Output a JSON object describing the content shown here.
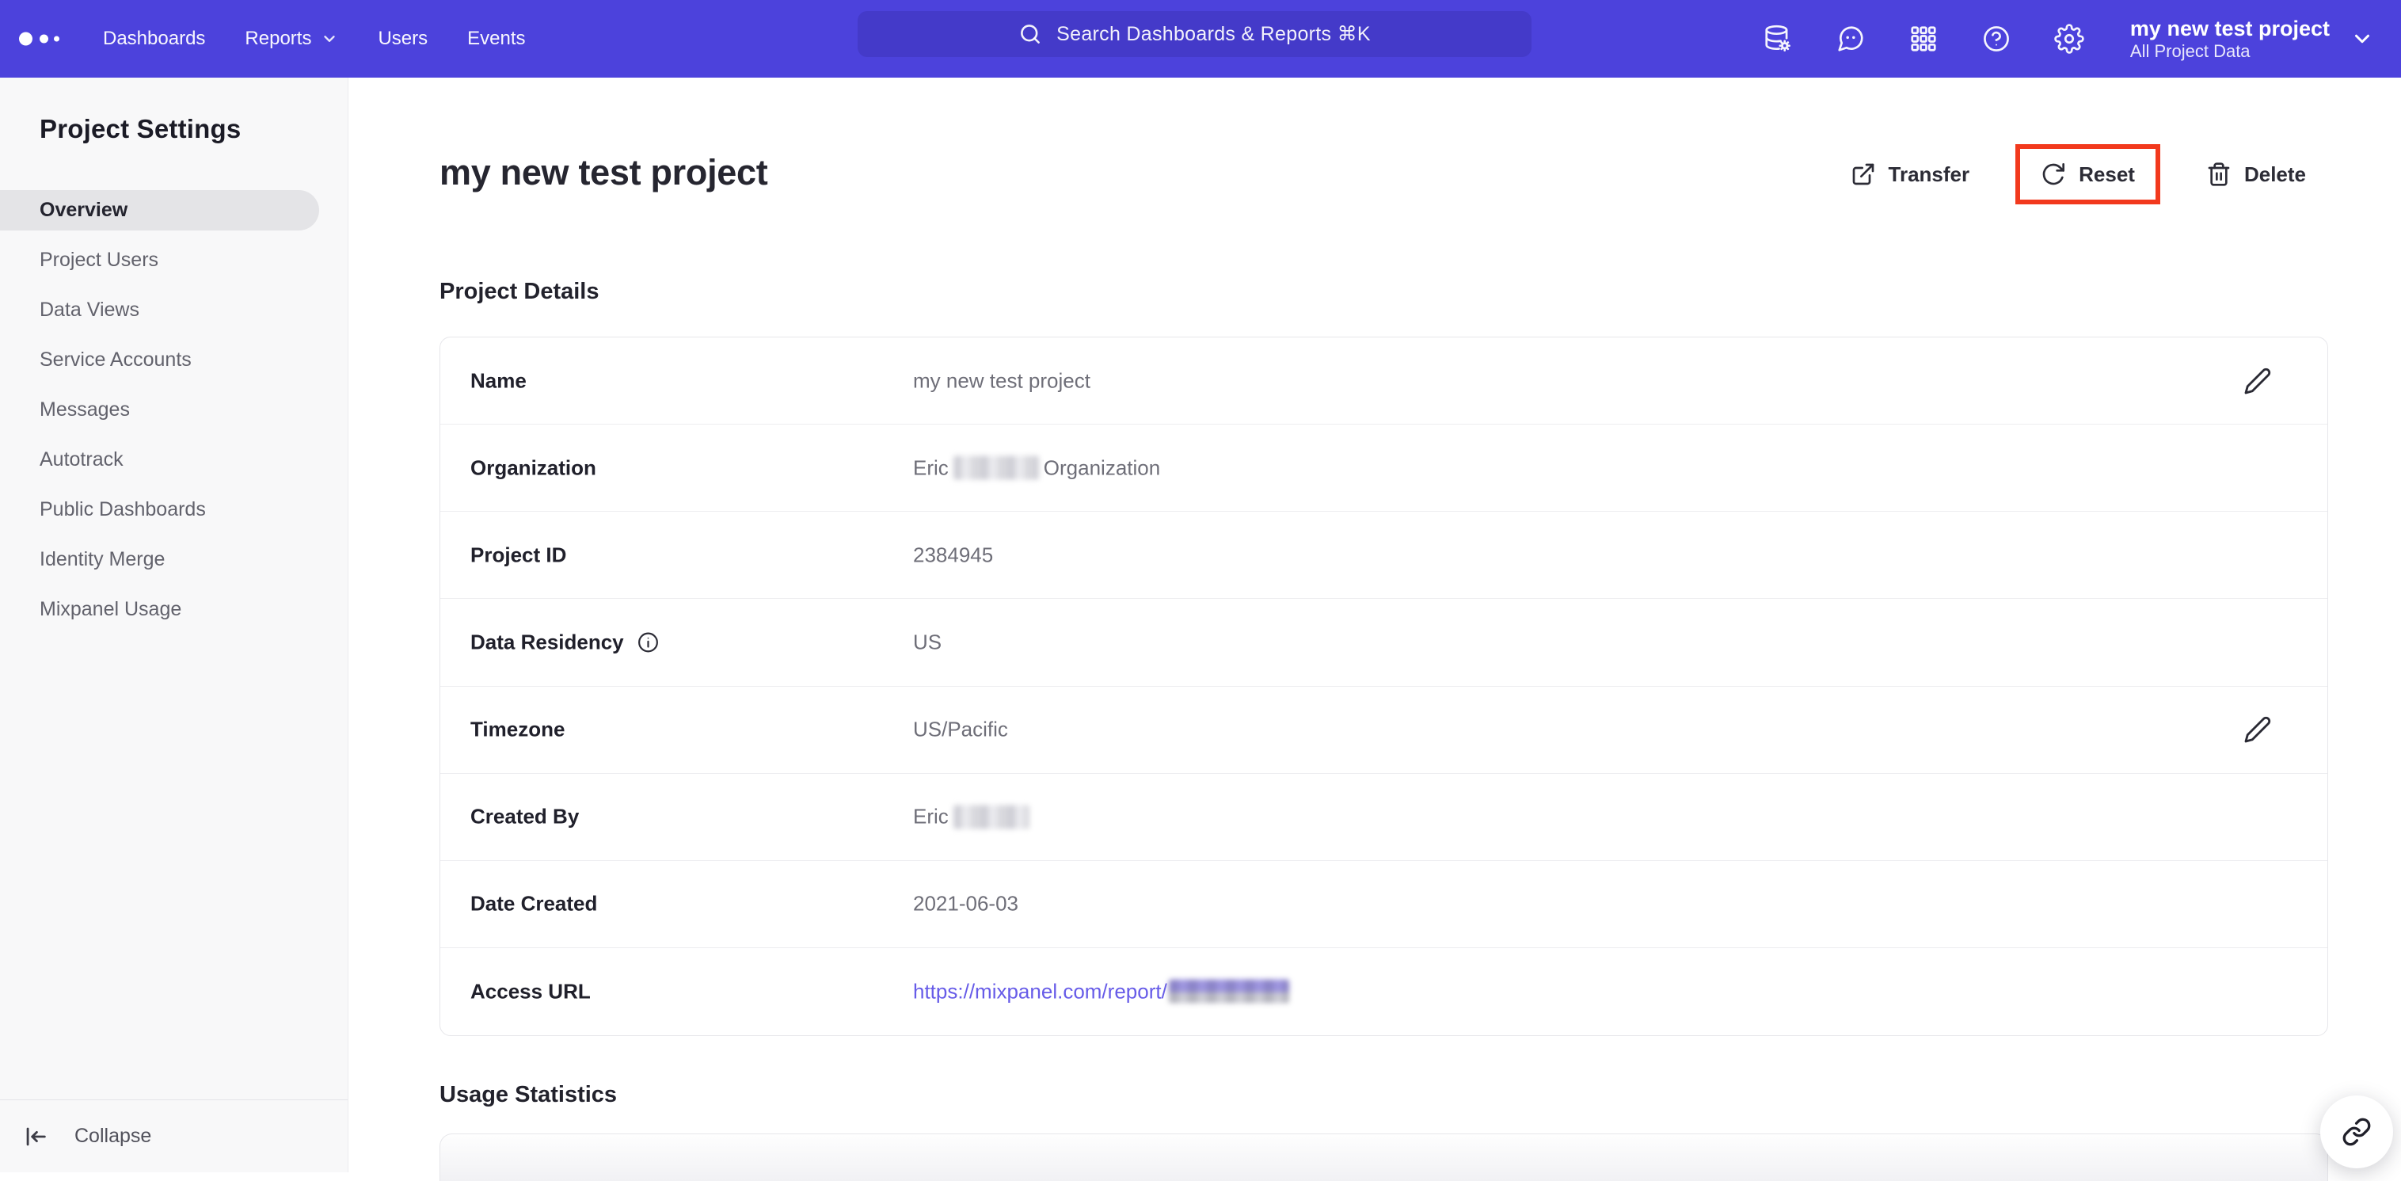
{
  "nav": {
    "items": [
      {
        "label": "Dashboards"
      },
      {
        "label": "Reports"
      },
      {
        "label": "Users"
      },
      {
        "label": "Events"
      }
    ],
    "search_placeholder": "Search Dashboards & Reports ⌘K",
    "project_name": "my new test project",
    "project_scope": "All Project Data"
  },
  "sidebar": {
    "title": "Project Settings",
    "items": [
      "Overview",
      "Project Users",
      "Data Views",
      "Service Accounts",
      "Messages",
      "Autotrack",
      "Public Dashboards",
      "Identity Merge",
      "Mixpanel Usage"
    ],
    "active_item": "Overview",
    "collapse_label": "Collapse"
  },
  "main": {
    "title": "my new test project",
    "actions": {
      "transfer": "Transfer",
      "reset": "Reset",
      "delete": "Delete"
    },
    "section_details": "Project Details",
    "section_usage": "Usage Statistics",
    "rows": [
      {
        "label": "Name",
        "value": "my new test project"
      },
      {
        "label": "Organization",
        "value_prefix": "Eric",
        "value_suffix": "Organization"
      },
      {
        "label": "Project ID",
        "value": "2384945"
      },
      {
        "label": "Data Residency",
        "value": "US"
      },
      {
        "label": "Timezone",
        "value": "US/Pacific"
      },
      {
        "label": "Created By",
        "value_prefix": "Eric"
      },
      {
        "label": "Date Created",
        "value": "2021-06-03"
      },
      {
        "label": "Access URL",
        "value_link": "https://mixpanel.com/report/"
      }
    ]
  },
  "colors": {
    "nav_purple": "#4c42dc",
    "highlight_red": "#f2391d",
    "link_purple": "#675ce8"
  }
}
